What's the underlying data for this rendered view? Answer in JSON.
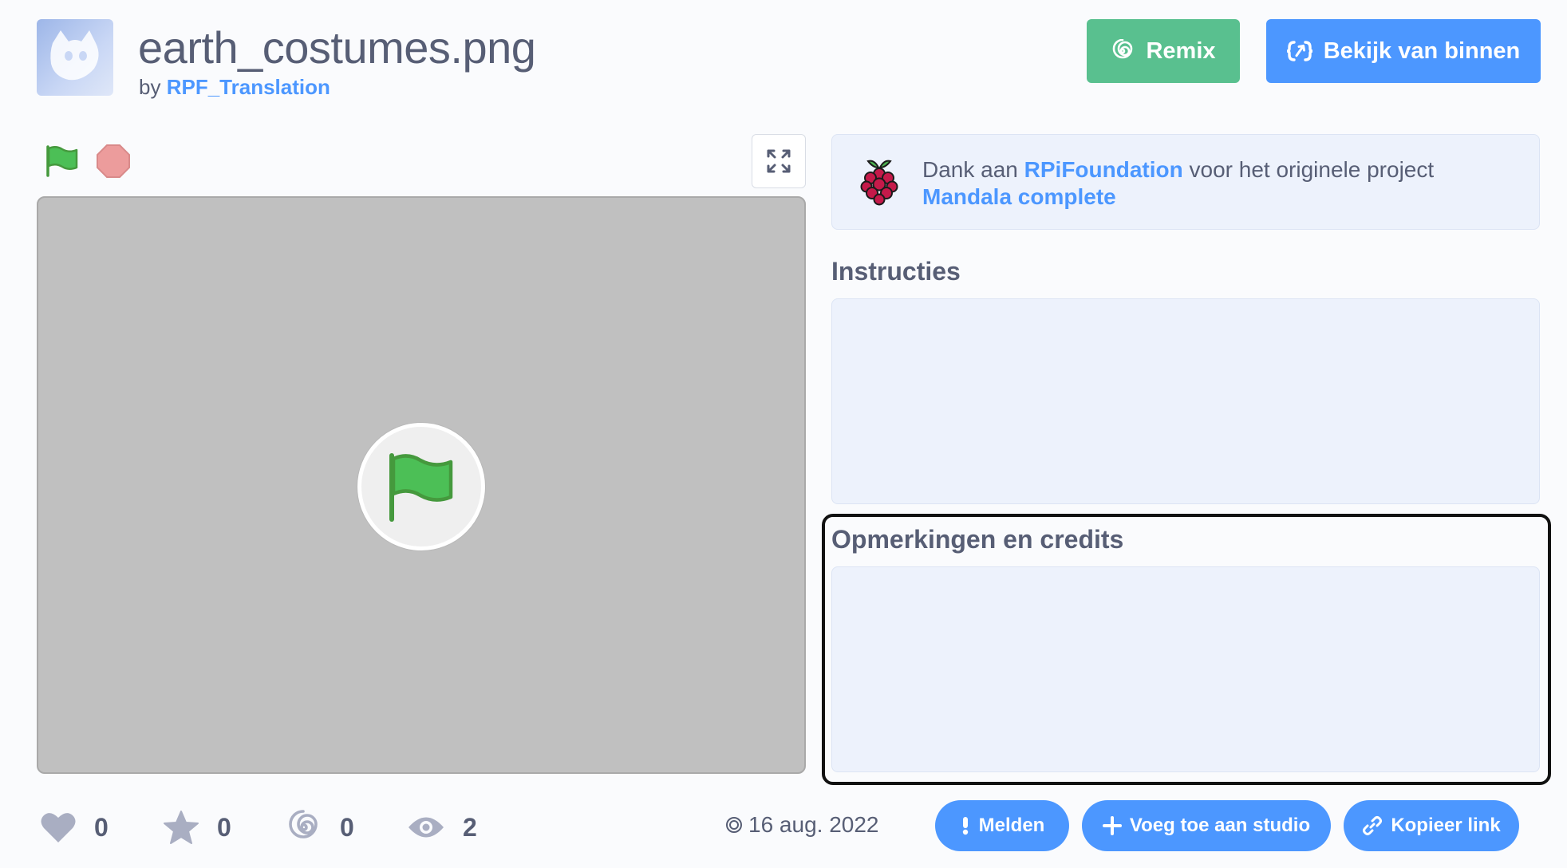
{
  "header": {
    "title": "earth_costumes.png",
    "by_prefix": "by",
    "author": "RPF_Translation"
  },
  "actions": {
    "remix_label": "Remix",
    "see_inside_label": "Bekijk van binnen"
  },
  "attribution": {
    "prefix": "Dank aan",
    "org": "RPiFoundation",
    "middle": "voor het originele project",
    "project": "Mandala complete"
  },
  "sections": {
    "instructions_title": "Instructies",
    "notes_title": "Opmerkingen en credits"
  },
  "stats": {
    "loves": "0",
    "favorites": "0",
    "remixes": "0",
    "views": "2"
  },
  "date": "16 aug. 2022",
  "footer_buttons": {
    "report": "Melden",
    "add_to_studio": "Voeg toe aan studio",
    "copy_link": "Kopieer link"
  },
  "colors": {
    "remix_green": "#59c08f",
    "scratch_blue": "#4c97ff",
    "stage_gray": "#c0c0c0",
    "panel_bg": "#edf2fc",
    "text": "#575e75"
  }
}
